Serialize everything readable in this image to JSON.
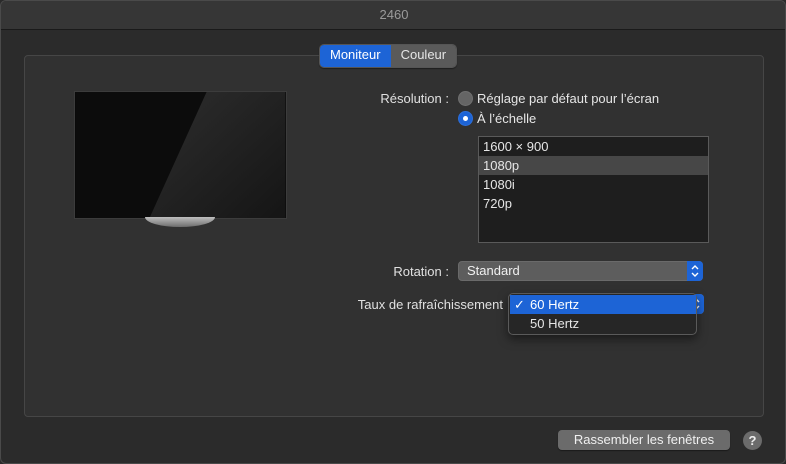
{
  "window": {
    "title": "2460"
  },
  "tabs": [
    {
      "label": "Moniteur",
      "active": true
    },
    {
      "label": "Couleur",
      "active": false
    }
  ],
  "resolution": {
    "label": "Résolution :",
    "options": [
      {
        "label": "Réglage par défaut pour l’écran",
        "selected": false
      },
      {
        "label": "À l’échelle",
        "selected": true
      }
    ],
    "list": [
      {
        "label": "1600 × 900",
        "selected": false
      },
      {
        "label": "1080p",
        "selected": true
      },
      {
        "label": "1080i",
        "selected": false
      },
      {
        "label": "720p",
        "selected": false
      }
    ]
  },
  "rotation": {
    "label": "Rotation :",
    "value": "Standard"
  },
  "refresh": {
    "label": "Taux de rafraîchissement",
    "options": [
      {
        "label": "60 Hertz",
        "selected": true,
        "check": "✓"
      },
      {
        "label": "50 Hertz",
        "selected": false,
        "check": ""
      }
    ]
  },
  "footer": {
    "gather_label": "Rassembler les fenêtres",
    "help_label": "?"
  },
  "colors": {
    "accent": "#1d64d6",
    "window_bg": "#2b2b2b",
    "panel_bg": "#313131"
  }
}
